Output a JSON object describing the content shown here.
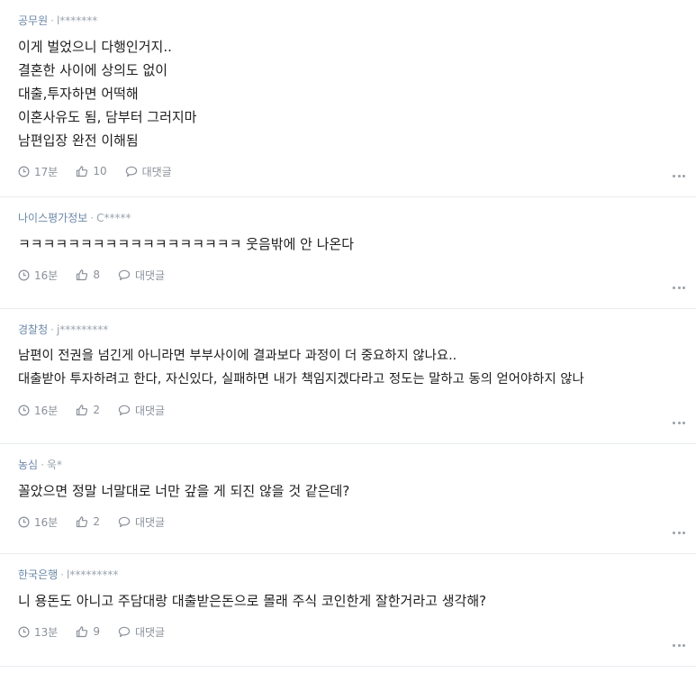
{
  "labels": {
    "reply": "대댓글"
  },
  "comments": [
    {
      "author": "공무원",
      "user_id": "l*******",
      "lines": [
        "이게 벌었으니 다행인거지..",
        "결혼한 사이에 상의도 없이",
        "대출,투자하면 어떡해",
        "이혼사유도 됨, 담부터 그러지마",
        "남편입장 완전 이해됨"
      ],
      "time": "17분",
      "likes": "10"
    },
    {
      "author": "나이스평가정보",
      "user_id": "C*****",
      "lines": [
        "ㅋㅋㅋㅋㅋㅋㅋㅋㅋㅋㅋㅋㅋㅋㅋㅋㅋㅋ 웃음밖에 안 나온다"
      ],
      "time": "16분",
      "likes": "8"
    },
    {
      "author": "경찰청",
      "user_id": "j*********",
      "lines": [
        "남편이 전권을 넘긴게 아니라면 부부사이에 결과보다 과정이 더 중요하지 않나요..",
        "대출받아 투자하려고 한다, 자신있다, 실패하면 내가 책임지겠다라고 정도는 말하고 동의 얻어야하지 않나"
      ],
      "time": "16분",
      "likes": "2"
    },
    {
      "author": "농심",
      "user_id": "욱*",
      "lines": [
        "꼴았으면 정말 너말대로 너만 갚을 게 되진 않을 것 같은데?"
      ],
      "time": "16분",
      "likes": "2"
    },
    {
      "author": "한국은행",
      "user_id": "l*********",
      "lines": [
        "니 용돈도 아니고 주담대랑 대출받은돈으로 몰래 주식 코인한게 잘한거라고 생각해?"
      ],
      "time": "13분",
      "likes": "9"
    }
  ]
}
